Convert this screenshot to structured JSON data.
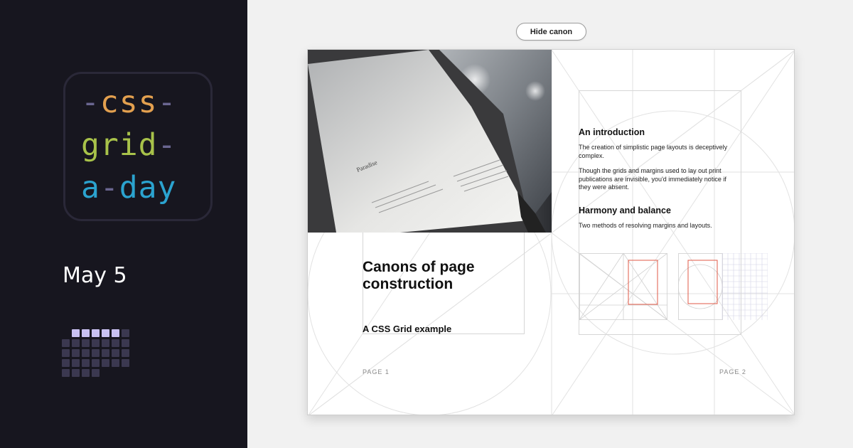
{
  "logo": {
    "line1": {
      "dash_left": "-",
      "word": "css",
      "dash_right": "-"
    },
    "line2": {
      "word": "grid",
      "dash_right": "-"
    },
    "line3": {
      "word": "a",
      "dash_mid": "-",
      "word2": "day"
    }
  },
  "sidebar": {
    "date": "May 5",
    "calendar": {
      "done_days": 5,
      "total_days": 31,
      "leading_blank": 1,
      "colors": {
        "done": "#c9c1f2",
        "todo": "#3b3850"
      }
    }
  },
  "toolbar": {
    "toggle_label": "Hide canon"
  },
  "spread": {
    "photo": {
      "caption_word": "Paradise"
    },
    "page1": {
      "title": "Canons of page construction",
      "subtitle": "A CSS Grid example",
      "page_label": "PAGE 1"
    },
    "page2": {
      "heading1": "An introduction",
      "para1": "The creation of simplistic page layouts is deceptively complex.",
      "para2": "Though the grids and margins used to lay out print publications are invisible, you'd immediately notice if they were absent.",
      "heading2": "Harmony and balance",
      "para3": "Two methods of resolving margins and layouts.",
      "page_label": "PAGE 2"
    }
  },
  "colors": {
    "panel_bg": "#17161f",
    "logo_orange": "#e3a04f",
    "logo_green": "#a8c24a",
    "logo_blue": "#2ba3cf",
    "logo_dash": "#6a6690",
    "diagram_red": "#e05a47",
    "canon_lines": "#e2e2e2"
  }
}
